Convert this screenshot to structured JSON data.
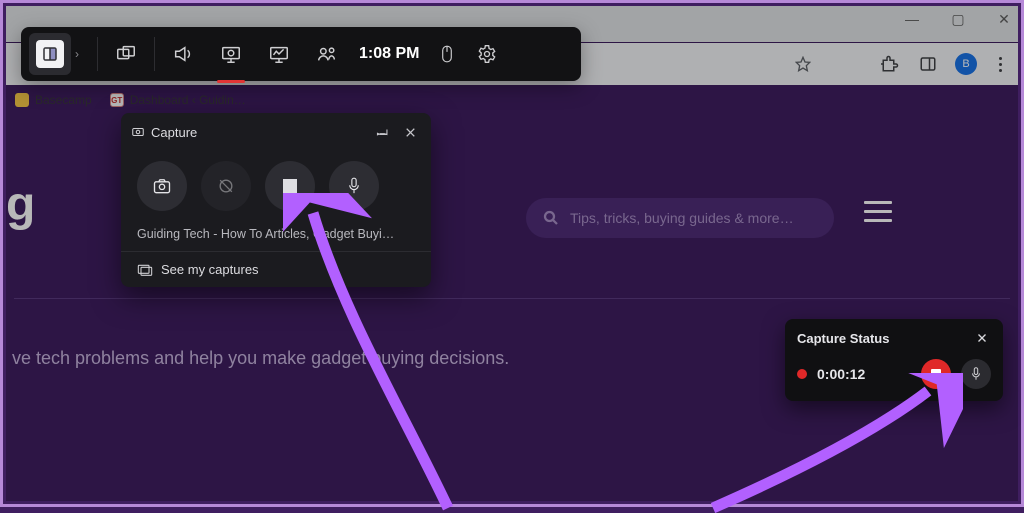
{
  "window": {
    "minimize": "—",
    "maximize": "▢",
    "close": "✕"
  },
  "bookmarks": [
    {
      "label": "Basecamp"
    },
    {
      "label": "Dashboard ‹ Guidin…",
      "badge": "GT"
    }
  ],
  "browser": {
    "avatar_letter": "B"
  },
  "page": {
    "logo_fragment": "g",
    "search_placeholder": "Tips, tricks, buying guides & more…",
    "tagline": "ve tech problems and help you make gadget buying decisions."
  },
  "gamebar": {
    "time": "1:08 PM"
  },
  "capture": {
    "title": "Capture",
    "window_title": "Guiding Tech - How To Articles, Gadget Buyi…",
    "see_captures": "See my captures"
  },
  "status": {
    "title": "Capture Status",
    "elapsed": "0:00:12"
  }
}
